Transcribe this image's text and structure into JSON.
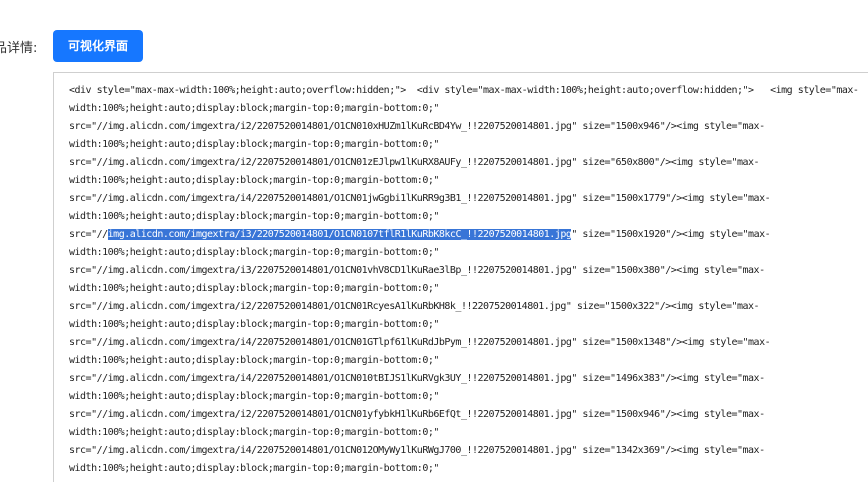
{
  "form": {
    "label": "品详情:",
    "visual_button_label": "可视化界面"
  },
  "editor": {
    "lines": [
      {
        "text": "<div style=\"max-max-width:100%;height:auto;overflow:hidden;\">  <div style=\"max-max-width:100%;height:auto;overflow:hidden;\">   <img style=\"max-"
      },
      {
        "text": "width:100%;height:auto;display:block;margin-top:0;margin-bottom:0;\""
      },
      {
        "text": "src=\"//img.alicdn.com/imgextra/i2/2207520014801/O1CN010xHUZm1lKuRcBD4Yw_!!2207520014801.jpg\" size=\"1500x946\"/><img style=\"max-"
      },
      {
        "text": "width:100%;height:auto;display:block;margin-top:0;margin-bottom:0;\""
      },
      {
        "text": "src=\"//img.alicdn.com/imgextra/i2/2207520014801/O1CN01zEJlpw1lKuRX8AUFy_!!2207520014801.jpg\" size=\"650x800\"/><img style=\"max-"
      },
      {
        "text": "width:100%;height:auto;display:block;margin-top:0;margin-bottom:0;\""
      },
      {
        "text": "src=\"//img.alicdn.com/imgextra/i4/2207520014801/O1CN01jwGgbi1lKuRR9g3B1_!!2207520014801.jpg\" size=\"1500x1779\"/><img style=\"max-"
      },
      {
        "text": "width:100%;height:auto;display:block;margin-top:0;margin-bottom:0;\""
      },
      {
        "pre": "src=\"//",
        "highlight": "img.alicdn.com/imgextra/i3/2207520014801/O1CN0107tflR1lKuRbK8kcC_!!2207520014801.jpg",
        "post": "\" size=\"1500x1920\"/><img style=\"max-"
      },
      {
        "text": "width:100%;height:auto;display:block;margin-top:0;margin-bottom:0;\""
      },
      {
        "text": "src=\"//img.alicdn.com/imgextra/i3/2207520014801/O1CN01vhV8CD1lKuRae3lBp_!!2207520014801.jpg\" size=\"1500x380\"/><img style=\"max-"
      },
      {
        "text": "width:100%;height:auto;display:block;margin-top:0;margin-bottom:0;\""
      },
      {
        "text": "src=\"//img.alicdn.com/imgextra/i2/2207520014801/O1CN01RcyesA1lKuRbKH8k_!!2207520014801.jpg\" size=\"1500x322\"/><img style=\"max-"
      },
      {
        "text": "width:100%;height:auto;display:block;margin-top:0;margin-bottom:0;\""
      },
      {
        "text": "src=\"//img.alicdn.com/imgextra/i4/2207520014801/O1CN01GTlpf61lKuRdJbPym_!!2207520014801.jpg\" size=\"1500x1348\"/><img style=\"max-"
      },
      {
        "text": "width:100%;height:auto;display:block;margin-top:0;margin-bottom:0;\""
      },
      {
        "text": "src=\"//img.alicdn.com/imgextra/i4/2207520014801/O1CN010tBIJS1lKuRVgk3UY_!!2207520014801.jpg\" size=\"1496x383\"/><img style=\"max-"
      },
      {
        "text": "width:100%;height:auto;display:block;margin-top:0;margin-bottom:0;\""
      },
      {
        "text": "src=\"//img.alicdn.com/imgextra/i2/2207520014801/O1CN01yfybkH1lKuRb6EfQt_!!2207520014801.jpg\" size=\"1500x946\"/><img style=\"max-"
      },
      {
        "text": "width:100%;height:auto;display:block;margin-top:0;margin-bottom:0;\""
      },
      {
        "text": "src=\"//img.alicdn.com/imgextra/i4/2207520014801/O1CN012OMyWy1lKuRWgJ700_!!2207520014801.jpg\" size=\"1342x369\"/><img style=\"max-"
      },
      {
        "text": "width:100%;height:auto;display:block;margin-top:0;margin-bottom:0;\""
      }
    ]
  }
}
